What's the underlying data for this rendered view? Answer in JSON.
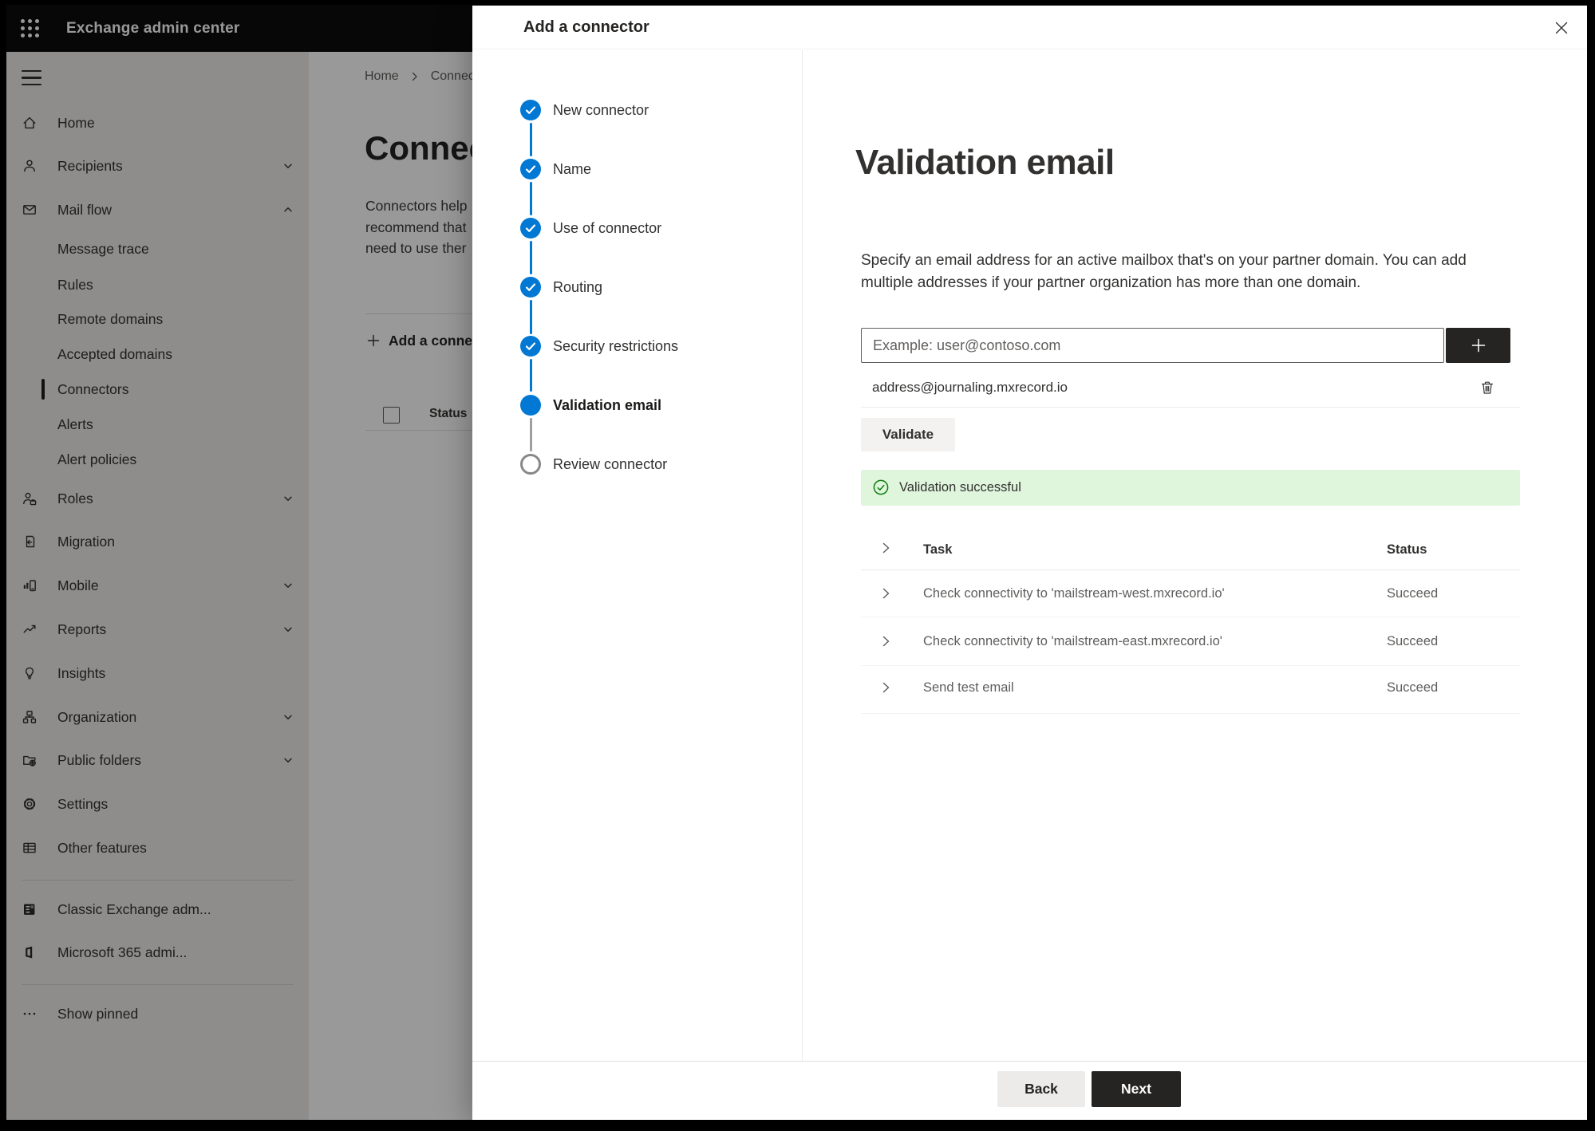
{
  "app": {
    "title": "Exchange admin center"
  },
  "sidebar": {
    "items": [
      {
        "label": "Home"
      },
      {
        "label": "Recipients"
      },
      {
        "label": "Mail flow"
      },
      {
        "label": "Message trace"
      },
      {
        "label": "Rules"
      },
      {
        "label": "Remote domains"
      },
      {
        "label": "Accepted domains"
      },
      {
        "label": "Connectors"
      },
      {
        "label": "Alerts"
      },
      {
        "label": "Alert policies"
      },
      {
        "label": "Roles"
      },
      {
        "label": "Migration"
      },
      {
        "label": "Mobile"
      },
      {
        "label": "Reports"
      },
      {
        "label": "Insights"
      },
      {
        "label": "Organization"
      },
      {
        "label": "Public folders"
      },
      {
        "label": "Settings"
      },
      {
        "label": "Other features"
      },
      {
        "label": "Classic Exchange adm..."
      },
      {
        "label": "Microsoft 365 admi..."
      },
      {
        "label": "Show pinned"
      }
    ]
  },
  "background": {
    "breadcrumb": {
      "home": "Home",
      "current": "Connectors"
    },
    "title": "Connectors",
    "description_lines": [
      "Connectors help",
      "recommend that",
      "need to use ther"
    ],
    "add_button": "Add a connector",
    "column_status": "Status"
  },
  "dialog": {
    "title": "Add a connector",
    "steps": [
      {
        "label": "New connector",
        "state": "completed"
      },
      {
        "label": "Name",
        "state": "completed"
      },
      {
        "label": "Use of connector",
        "state": "completed"
      },
      {
        "label": "Routing",
        "state": "completed"
      },
      {
        "label": "Security restrictions",
        "state": "completed"
      },
      {
        "label": "Validation email",
        "state": "current"
      },
      {
        "label": "Review connector",
        "state": "upcoming"
      }
    ],
    "content": {
      "title": "Validation email",
      "description_lines": [
        "Specify an email address for an active mailbox that's on your partner domain. You can add",
        "multiple addresses if your partner organization has more than one domain."
      ],
      "email_input": {
        "placeholder": "Example: user@contoso.com"
      },
      "added_address": "address@journaling.mxrecord.io",
      "validate_button": "Validate",
      "success_message": "Validation successful",
      "table": {
        "headers": {
          "task": "Task",
          "status": "Status"
        },
        "rows": [
          {
            "task": "Check connectivity to 'mailstream-west.mxrecord.io'",
            "status": "Succeed"
          },
          {
            "task": "Check connectivity to 'mailstream-east.mxrecord.io'",
            "status": "Succeed"
          },
          {
            "task": "Send test email",
            "status": "Succeed"
          }
        ]
      }
    },
    "footer": {
      "back": "Back",
      "next": "Next"
    }
  },
  "colors": {
    "accent": "#0078d4",
    "success_bg": "#dff6dd",
    "success_green": "#107c10"
  }
}
